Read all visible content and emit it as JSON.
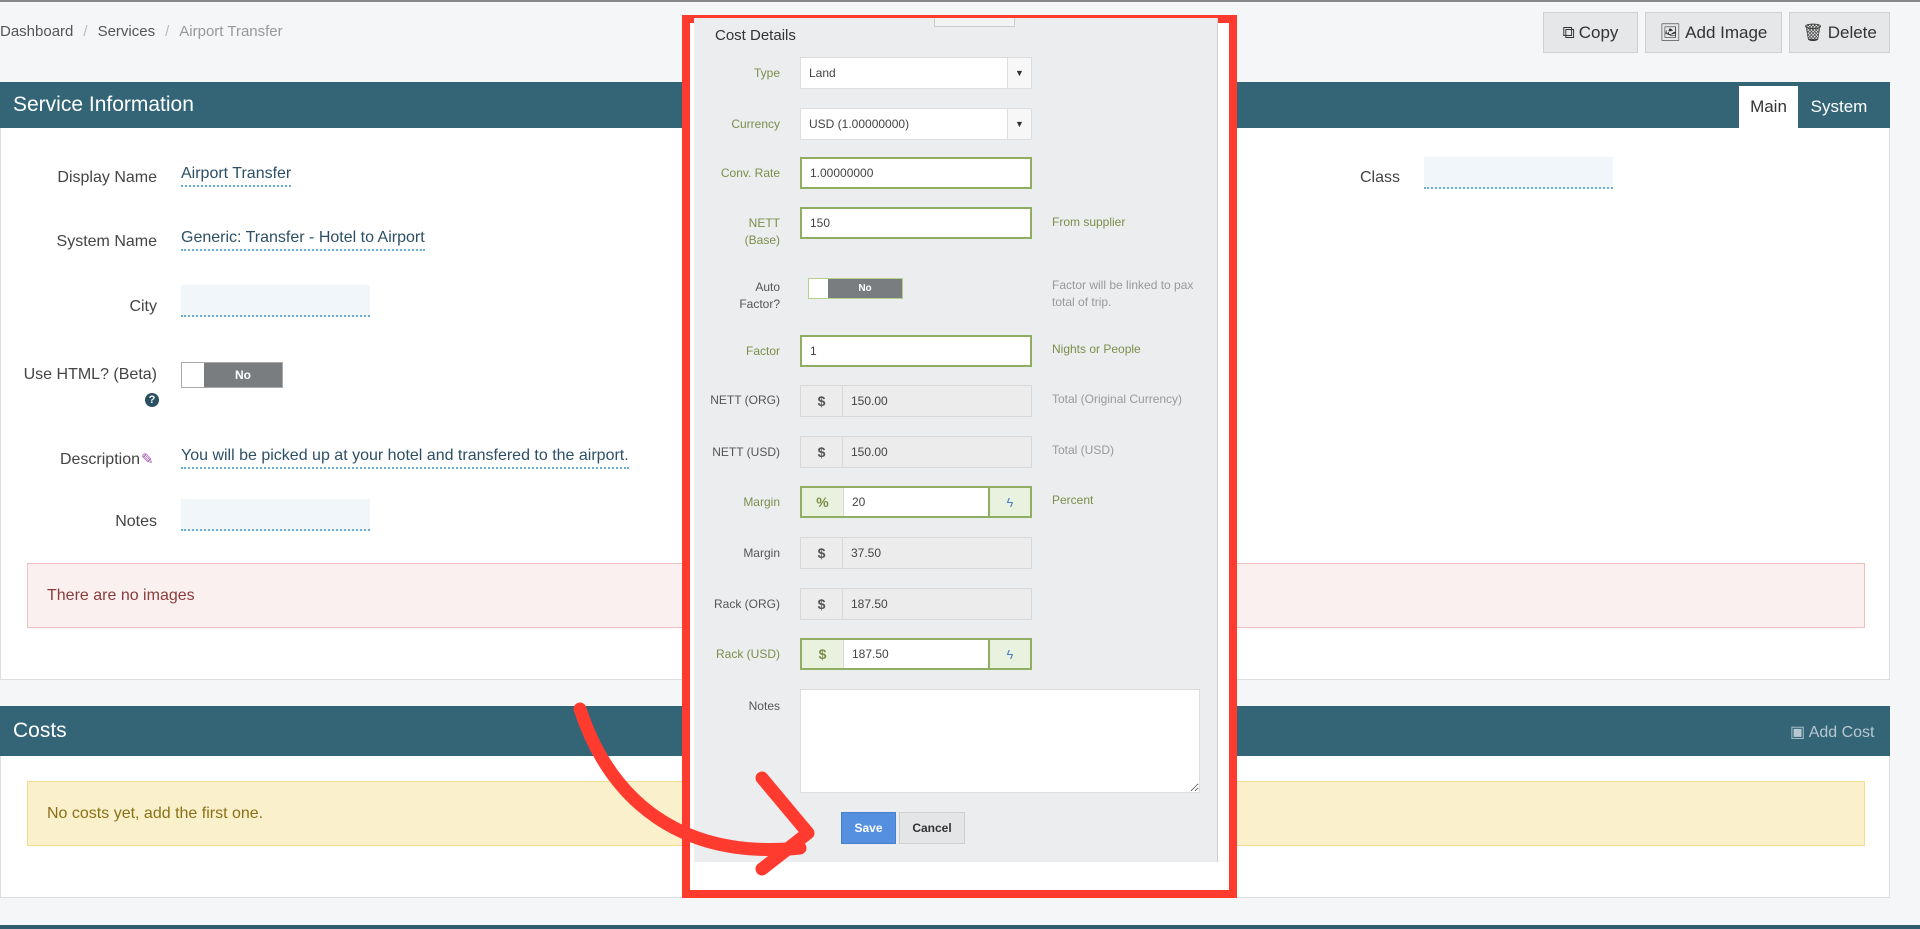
{
  "breadcrumb": [
    "Dashboard",
    "Services",
    "Airport Transfer"
  ],
  "toolbar": {
    "copy": "Copy",
    "add_image": "Add Image",
    "delete": "Delete"
  },
  "service": {
    "title": "Service Information",
    "tabs": [
      "Main",
      "System"
    ],
    "display_name_label": "Display Name",
    "display_name": "Airport Transfer",
    "system_name_label": "System Name",
    "system_name": "Generic: Transfer - Hotel to Airport",
    "city_label": "City",
    "city": "",
    "use_html_label": "Use HTML? (Beta)",
    "use_html": "No",
    "description_label": "Description",
    "description": "You will be picked up at your hotel and transfered to the airport.",
    "notes_label": "Notes",
    "notes": "",
    "class_label": "Class",
    "class": "",
    "no_images": "There are no images"
  },
  "costs": {
    "title": "Costs",
    "add_cost": "Add Cost",
    "empty": "No costs yet, add the first one."
  },
  "modal": {
    "title": "Cost Details",
    "type_label": "Type",
    "type": "Land",
    "currency_label": "Currency",
    "currency": "USD (1.00000000)",
    "conv_label": "Conv. Rate",
    "conv": "1.00000000",
    "nett_base_label": "NETT (Base)",
    "nett_base": "150",
    "nett_base_help": "From supplier",
    "auto_factor_label": "Auto Factor?",
    "auto_factor": "No",
    "auto_factor_help": "Factor will be linked to pax total of trip.",
    "factor_label": "Factor",
    "factor": "1",
    "factor_help": "Nights or People",
    "nett_org_label": "NETT (ORG)",
    "nett_org": "150.00",
    "nett_org_help": "Total (Original Currency)",
    "nett_usd_label": "NETT (USD)",
    "nett_usd": "150.00",
    "nett_usd_help": "Total (USD)",
    "margin_pct_label": "Margin",
    "margin_pct": "20",
    "margin_pct_help": "Percent",
    "margin_label": "Margin",
    "margin": "37.50",
    "rack_org_label": "Rack (ORG)",
    "rack_org": "187.50",
    "rack_usd_label": "Rack (USD)",
    "rack_usd": "187.50",
    "notes_label": "Notes",
    "notes": "",
    "currency_symbol": "$",
    "percent_symbol": "%",
    "save": "Save",
    "cancel": "Cancel"
  },
  "colors": {
    "header": "#336577",
    "highlight": "#ff3b30",
    "save": "#5590e0"
  }
}
